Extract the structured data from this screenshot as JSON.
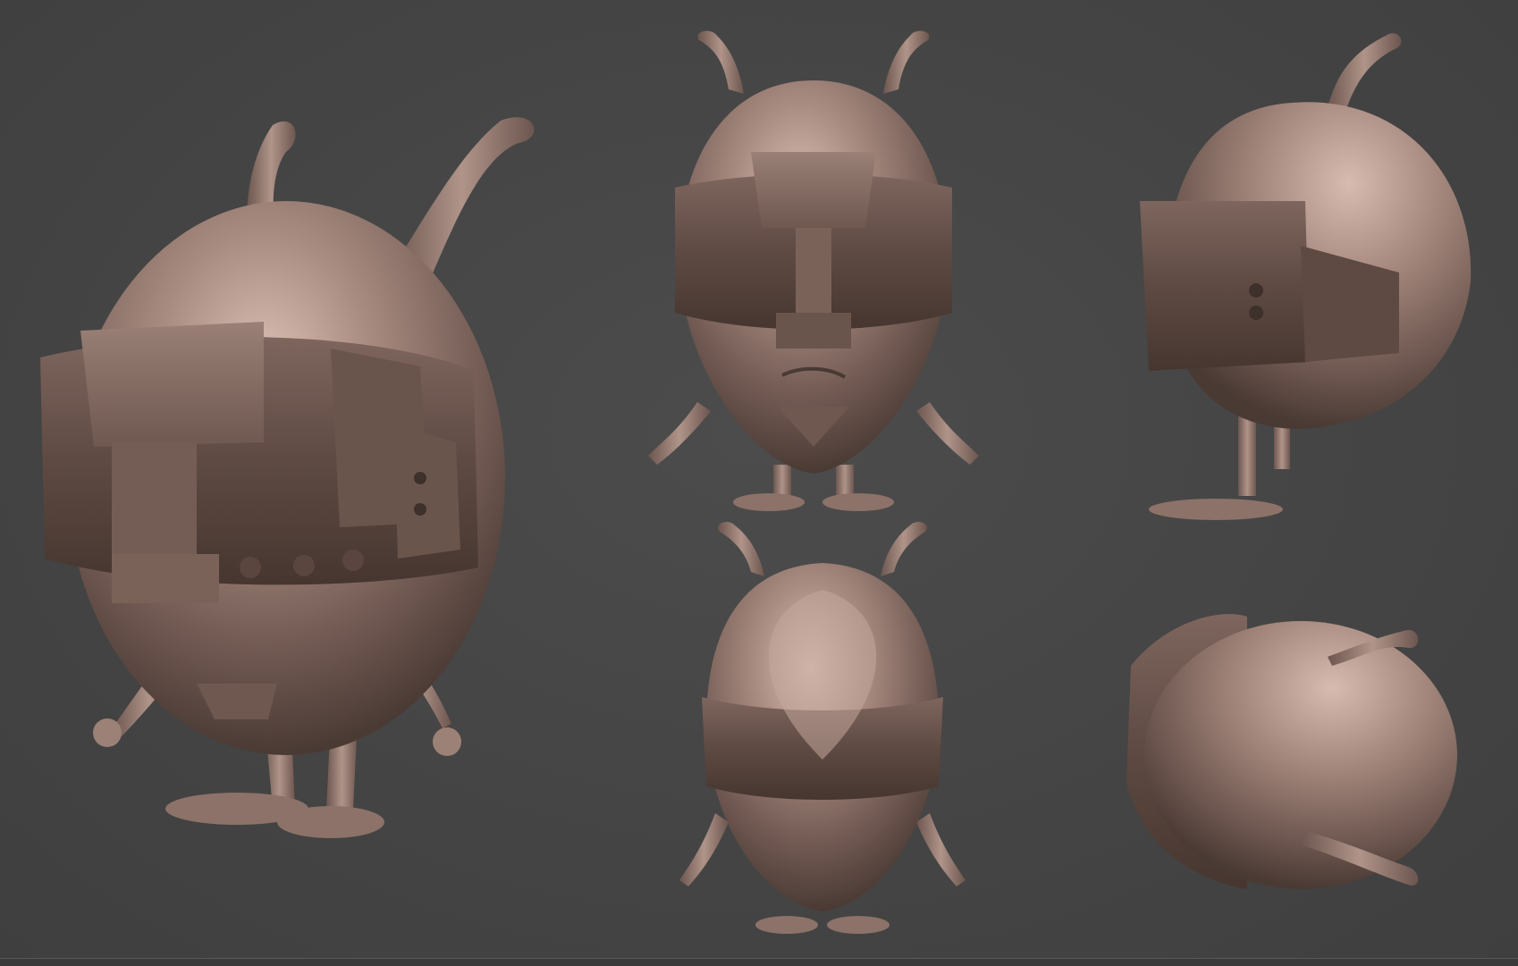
{
  "viewport": {
    "background": "#464646"
  },
  "material": {
    "skin_light": "#d6b8ad",
    "skin_mid": "#9c8176",
    "skin_dark": "#5a463f",
    "visor_light": "#8a7068",
    "visor_dark": "#4a3a35"
  },
  "views": [
    {
      "name": "three-quarter-view",
      "label": ""
    },
    {
      "name": "front-view",
      "label": ""
    },
    {
      "name": "side-view",
      "label": ""
    },
    {
      "name": "back-view",
      "label": ""
    },
    {
      "name": "top-view",
      "label": ""
    }
  ]
}
